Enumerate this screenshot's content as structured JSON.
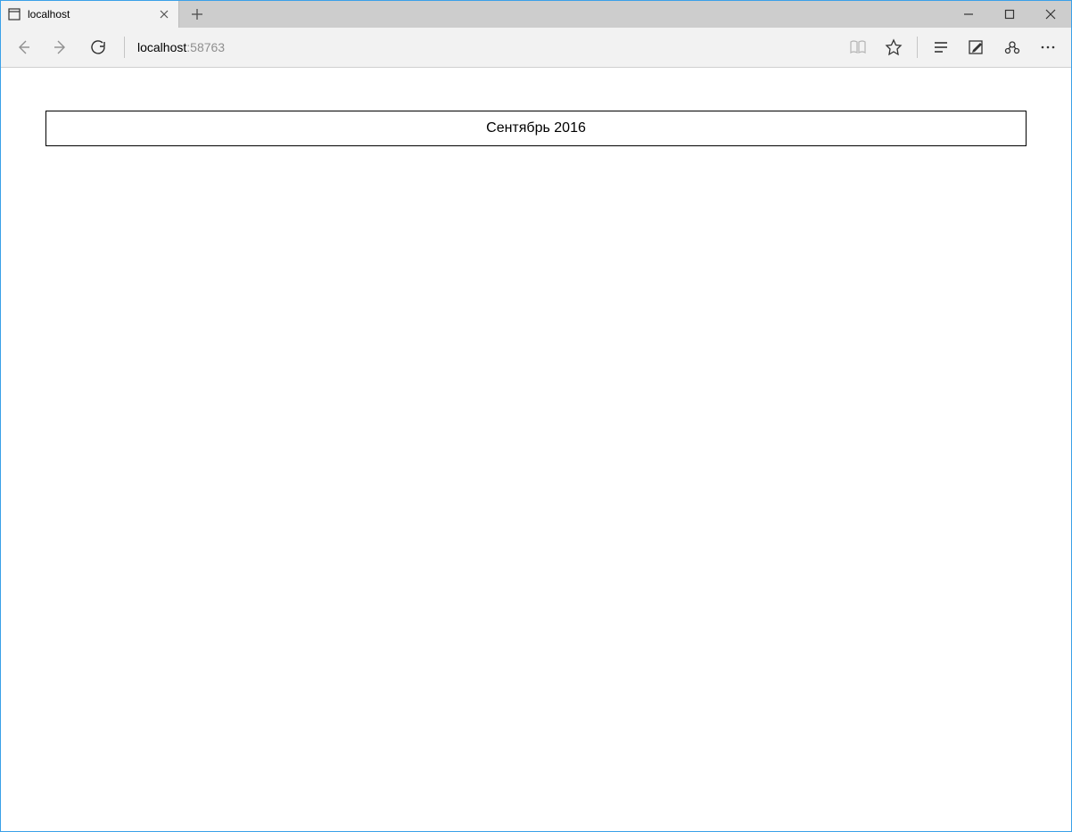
{
  "browser": {
    "tab_title": "localhost",
    "address_host": "localhost",
    "address_port": ":58763"
  },
  "page": {
    "calendar_header": "Сентябрь 2016"
  }
}
